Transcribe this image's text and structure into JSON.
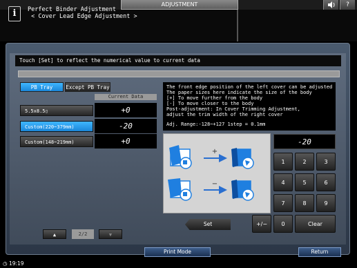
{
  "topbar": {
    "title": "ADJUSTMENT",
    "sound_icon": "speaker-icon",
    "help_label": "?"
  },
  "header": {
    "line1": "Perfect Binder Adjustment",
    "line2": " < Cover Lead Edge Adjustment >",
    "icon_label": "i"
  },
  "instruction": "Touch [Set] to reflect the numerical value to current data",
  "tabs": [
    {
      "label": "PB Tray",
      "active": true
    },
    {
      "label": "Except PB Tray",
      "active": false
    }
  ],
  "current_data_header": "Current Data",
  "rows": [
    {
      "label": "5.5x8.5▯",
      "value": "+0",
      "selected": false
    },
    {
      "label": "Custom(220~379mm)",
      "value": "-20",
      "selected": true
    },
    {
      "label": "Custom(148~219mm)",
      "value": "+0",
      "selected": false
    }
  ],
  "description": {
    "lines": [
      "The front edge position of the left cover can be adjusted",
      "The paper sizes here indicate the size of the body",
      "[+] To move further from the body",
      "[-] To move closer to the body",
      "Post-adjustment: In Cover Trimming Adjustment,",
      "adjust the trim width of the right cover",
      "",
      "Adj. Range:-128~+127 1step = 0.1mm"
    ]
  },
  "diagram": {
    "plus_symbol": "+",
    "minus_symbol": "−",
    "accent": "#1f7fe0"
  },
  "entry_value": "-20",
  "keypad": {
    "keys": [
      "1",
      "2",
      "3",
      "4",
      "5",
      "6",
      "7",
      "8",
      "9"
    ],
    "plus_minus": "+/−",
    "zero": "0",
    "clear": "Clear"
  },
  "set_label": "Set",
  "pager": {
    "up": "▲",
    "page": "2/2",
    "down": "▼"
  },
  "footer": {
    "print_mode": "Print Mode",
    "return": "Return"
  },
  "clock": "19:19"
}
